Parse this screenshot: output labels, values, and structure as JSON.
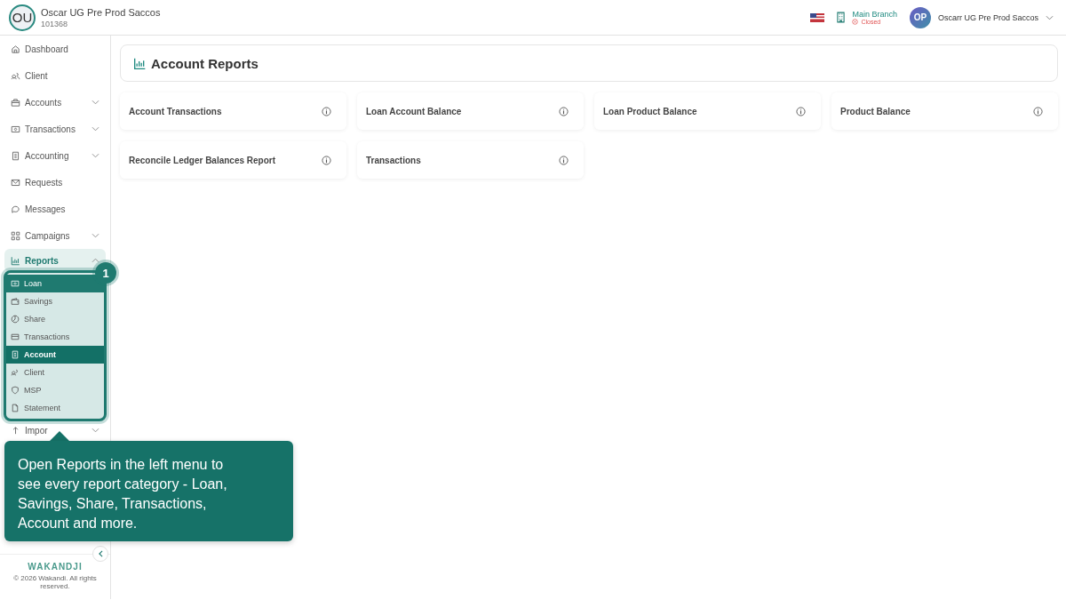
{
  "header": {
    "org_initials": "OU",
    "org_name": "Oscar UG Pre Prod Saccos",
    "org_code": "101368",
    "branch": "Main Branch",
    "branch_status": "Closed",
    "user_initials": "OP",
    "user_name": "Oscarr UG Pre Prod Saccos"
  },
  "sidebar": {
    "items": [
      {
        "label": "Dashboard",
        "expandable": false,
        "selected": false
      },
      {
        "label": "Client",
        "expandable": false,
        "selected": false
      },
      {
        "label": "Accounts",
        "expandable": true,
        "expanded": false,
        "selected": false
      },
      {
        "label": "Transactions",
        "expandable": true,
        "expanded": false,
        "selected": false
      },
      {
        "label": "Accounting",
        "expandable": true,
        "expanded": false,
        "selected": false
      },
      {
        "label": "Requests",
        "expandable": false,
        "selected": false
      },
      {
        "label": "Messages",
        "expandable": false,
        "selected": false
      },
      {
        "label": "Campaigns",
        "expandable": true,
        "expanded": false,
        "selected": false
      },
      {
        "label": "Reports",
        "expandable": true,
        "expanded": true,
        "selected": true
      }
    ],
    "submenu": [
      {
        "label": "Loan",
        "selected": false,
        "hovered": true
      },
      {
        "label": "Savings",
        "selected": false,
        "hovered": false
      },
      {
        "label": "Share",
        "selected": false,
        "hovered": false
      },
      {
        "label": "Transactions",
        "selected": false,
        "hovered": false
      },
      {
        "label": "Account",
        "selected": true,
        "hovered": false
      },
      {
        "label": "Client",
        "selected": false,
        "hovered": false
      },
      {
        "label": "MSP",
        "selected": false,
        "hovered": false
      },
      {
        "label": "Statement",
        "selected": false,
        "hovered": false
      }
    ],
    "after": [
      {
        "label": "Impor",
        "expandable": true
      }
    ],
    "brand": "WAKANDJI",
    "copyright": "© 2026 Wakandi. All rights reserved."
  },
  "page": {
    "title": "Account Reports",
    "reports": [
      "Account Transactions",
      "Loan Account Balance",
      "Loan Product Balance",
      "Product Balance",
      "Reconcile Ledger Balances Report",
      "Transactions"
    ]
  },
  "tour": {
    "step": "1",
    "text": "Open Reports in the left menu to see every report category - Loan, Savings, Share, Transactions, Account and more."
  }
}
